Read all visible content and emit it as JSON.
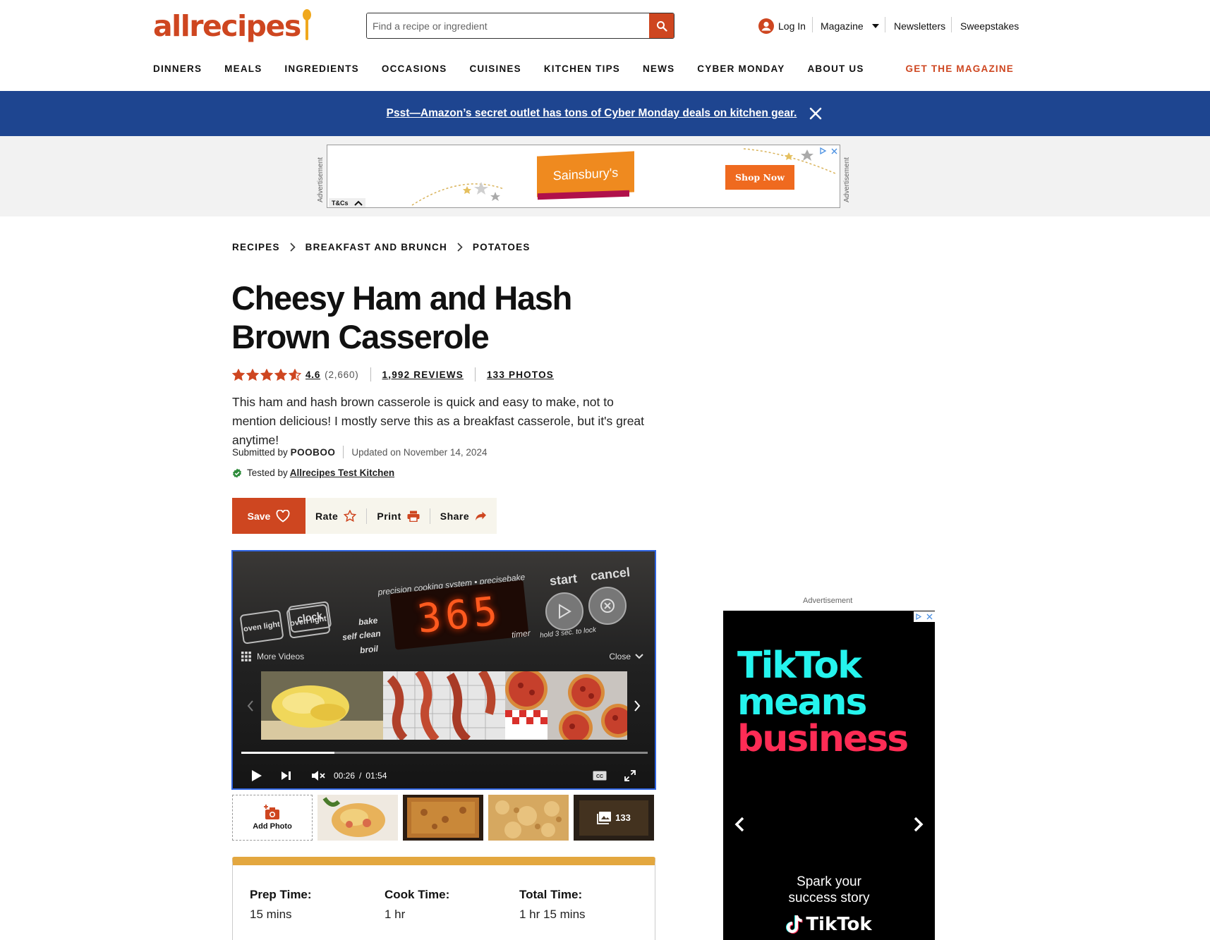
{
  "header": {
    "logo_text": "allrecipes",
    "search_placeholder": "Find a recipe or ingredient",
    "login_label": "Log In",
    "magazine_label": "Magazine",
    "newsletters_label": "Newsletters",
    "sweepstakes_label": "Sweepstakes",
    "brand_color": "#ce4620"
  },
  "nav": {
    "items": [
      "DINNERS",
      "MEALS",
      "INGREDIENTS",
      "OCCASIONS",
      "CUISINES",
      "KITCHEN TIPS",
      "NEWS",
      "CYBER MONDAY",
      "ABOUT US"
    ],
    "get_magazine": "GET THE MAGAZINE"
  },
  "promo": {
    "text": "Psst—Amazon’s secret outlet has tons of Cyber Monday deals on kitchen gear.",
    "bg_color": "#1e4590"
  },
  "top_ad": {
    "label": "Advertisement",
    "brand": "Sainsbury's",
    "cta": "Shop Now",
    "tcs": "T&Cs"
  },
  "breadcrumb": [
    "RECIPES",
    "BREAKFAST AND BRUNCH",
    "POTATOES"
  ],
  "recipe": {
    "title": "Cheesy Ham and Hash Brown Casserole",
    "rating": "4.6",
    "rating_stars": 4.6,
    "rating_count": "(2,660)",
    "reviews": "1,992 REVIEWS",
    "photos": "133 PHOTOS",
    "description": "This ham and hash brown casserole is quick and easy to make, not to mention delicious! I mostly serve this as a breakfast casserole, but it's great anytime!",
    "submitted_prefix": "Submitted by",
    "author": "POOBOO",
    "updated": "Updated on November 14, 2024",
    "tested_prefix": "Tested by",
    "tested_by": "Allrecipes Test Kitchen"
  },
  "actions": {
    "save": "Save",
    "rate": "Rate",
    "print": "Print",
    "share": "Share"
  },
  "video": {
    "more_videos": "More Videos",
    "close": "Close",
    "current_time": "00:26",
    "time_sep": "/",
    "duration": "01:54",
    "progress": 0.23,
    "display_digits": "365",
    "oven_labels": {
      "system": "precision cooking system • precisebake",
      "start": "start",
      "cancel": "cancel",
      "bake": "bake",
      "self_clean": "self clean",
      "broil": "broil",
      "timer": "timer",
      "hold": "hold 3 sec. to lock",
      "oven_light": "oven light",
      "clock": "clock"
    }
  },
  "photo_strip": {
    "add_photo": "Add Photo",
    "count": "133"
  },
  "details": {
    "prep_label": "Prep Time:",
    "prep_value": "15 mins",
    "cook_label": "Cook Time:",
    "cook_value": "1 hr",
    "total_label": "Total Time:",
    "total_value": "1 hr 15 mins"
  },
  "side_ad": {
    "label": "Advertisement",
    "line1": "TikTok",
    "line2": "means",
    "line3": "business",
    "sub1": "Spark your",
    "sub2": "success story",
    "brand": "TikTok"
  }
}
